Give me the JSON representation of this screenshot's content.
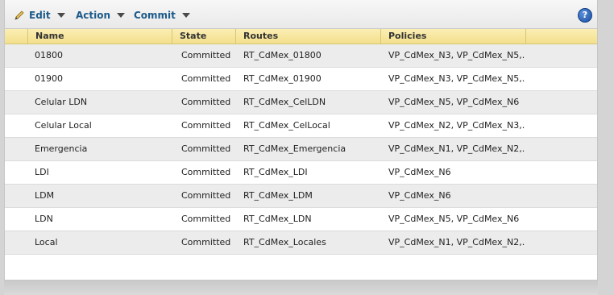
{
  "toolbar": {
    "edit_label": "Edit",
    "action_label": "Action",
    "commit_label": "Commit",
    "help_glyph": "?"
  },
  "columns": {
    "name": "Name",
    "state": "State",
    "routes": "Routes",
    "policies": "Policies"
  },
  "rows": [
    {
      "name": "01800",
      "state": "Committed",
      "routes": "RT_CdMex_01800",
      "policies": "VP_CdMex_N3, VP_CdMex_N5,..."
    },
    {
      "name": "01900",
      "state": "Committed",
      "routes": "RT_CdMex_01900",
      "policies": "VP_CdMex_N3, VP_CdMex_N5,..."
    },
    {
      "name": "Celular LDN",
      "state": "Committed",
      "routes": "RT_CdMex_CelLDN",
      "policies": "VP_CdMex_N5, VP_CdMex_N6"
    },
    {
      "name": "Celular Local",
      "state": "Committed",
      "routes": "RT_CdMex_CelLocal",
      "policies": "VP_CdMex_N2, VP_CdMex_N3,..."
    },
    {
      "name": "Emergencia",
      "state": "Committed",
      "routes": "RT_CdMex_Emergencia",
      "policies": "VP_CdMex_N1, VP_CdMex_N2,..."
    },
    {
      "name": "LDI",
      "state": "Committed",
      "routes": "RT_CdMex_LDI",
      "policies": "VP_CdMex_N6"
    },
    {
      "name": "LDM",
      "state": "Committed",
      "routes": "RT_CdMex_LDM",
      "policies": "VP_CdMex_N6"
    },
    {
      "name": "LDN",
      "state": "Committed",
      "routes": "RT_CdMex_LDN",
      "policies": "VP_CdMex_N5, VP_CdMex_N6"
    },
    {
      "name": "Local",
      "state": "Committed",
      "routes": "RT_CdMex_Locales",
      "policies": "VP_CdMex_N1, VP_CdMex_N2,..."
    }
  ],
  "colors": {
    "toolbar_text": "#1d5a8a",
    "header_bg": "#f3e08c",
    "row_alt_bg": "#ececec",
    "help_icon": "#1a4fa3"
  }
}
